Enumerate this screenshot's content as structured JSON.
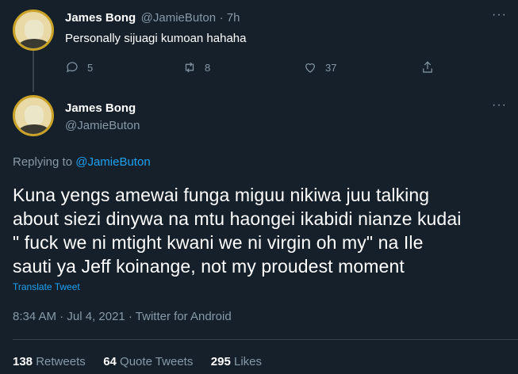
{
  "reply_tweet": {
    "name": "James Bong",
    "handle": "@JamieButon",
    "time": "· 7h",
    "text": "Personally sijuagi kumoan hahaha",
    "replies": "5",
    "retweets": "8",
    "likes": "37"
  },
  "main_tweet": {
    "name": "James Bong",
    "handle": "@JamieButon",
    "replying_prefix": "Replying to",
    "replying_to": "@JamieButon",
    "text_lines": [
      "Kuna yengs amewai funga miguu nikiwa juu talking",
      "about siezi dinywa na mtu haongei ikabidi nianze kudai",
      "\" fuck we ni mtight kwani we ni virgin oh my\" na Ile",
      "sauti ya Jeff koinange, not my proudest moment"
    ],
    "translate": "Translate Tweet",
    "timestamp": "8:34 AM · Jul 4, 2021 · Twitter for Android",
    "retweets_count": "138",
    "retweets_label": "Retweets",
    "quotes_count": "64",
    "quotes_label": "Quote Tweets",
    "likes_count": "295",
    "likes_label": "Likes"
  },
  "icons": [
    "more-icon",
    "reply-icon",
    "retweet-icon",
    "like-icon",
    "share-icon"
  ],
  "colors": {
    "background": "#15202b",
    "muted": "#8899a6",
    "link": "#1da1f2",
    "divider": "#38444d"
  }
}
